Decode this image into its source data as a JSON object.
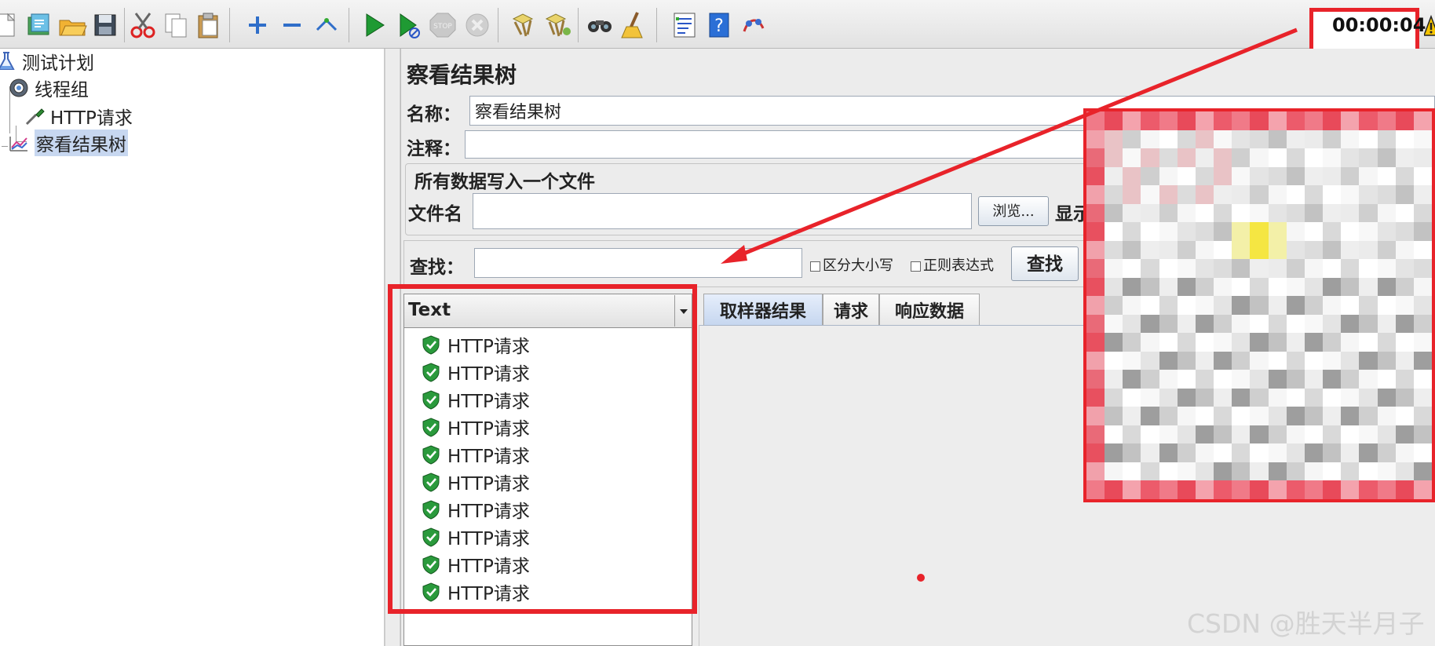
{
  "toolbar": {
    "timer": "00:00:04",
    "icons": [
      "new-icon",
      "templates-icon",
      "open-icon",
      "save-icon",
      "cut-icon",
      "copy-icon",
      "paste-icon",
      "expand-icon",
      "collapse-icon",
      "toggle-icon",
      "start-icon",
      "start-no-pause-icon",
      "stop-icon",
      "shutdown-icon",
      "clear-icon",
      "clear-all-icon",
      "search-icon",
      "reset-search-icon",
      "function-helper-icon",
      "help-icon",
      "remote-icon"
    ]
  },
  "tree": {
    "items": [
      {
        "label": "测试计划",
        "icon": "flask-icon"
      },
      {
        "label": "线程组",
        "icon": "gear-icon"
      },
      {
        "label": "HTTP请求",
        "icon": "pipette-icon"
      },
      {
        "label": "察看结果树",
        "icon": "graph-icon"
      }
    ]
  },
  "panel": {
    "title": "察看结果树",
    "name_label": "名称：",
    "name_value": "察看结果树",
    "comment_label": "注释：",
    "file_group_label": "所有数据写入一个文件",
    "filename_label": "文件名",
    "browse_button": "浏览...",
    "display_label_partial": "显示",
    "search_label": "查找：",
    "search_value": "",
    "case_sensitive_label": "区分大小写",
    "regex_label": "正则表达式",
    "find_button": "查找"
  },
  "results": {
    "renderer": "Text",
    "items": [
      "HTTP请求",
      "HTTP请求",
      "HTTP请求",
      "HTTP请求",
      "HTTP请求",
      "HTTP请求",
      "HTTP请求",
      "HTTP请求",
      "HTTP请求",
      "HTTP请求"
    ],
    "status_icon": "success-shield-icon"
  },
  "tabs": [
    "取样器结果",
    "请求",
    "响应数据"
  ],
  "colors": {
    "highlight_red": "#e8232a",
    "success_green": "#2a9a3c",
    "selection_blue": "#c7d7f0"
  },
  "watermark": "CSDN @胜天半月子"
}
